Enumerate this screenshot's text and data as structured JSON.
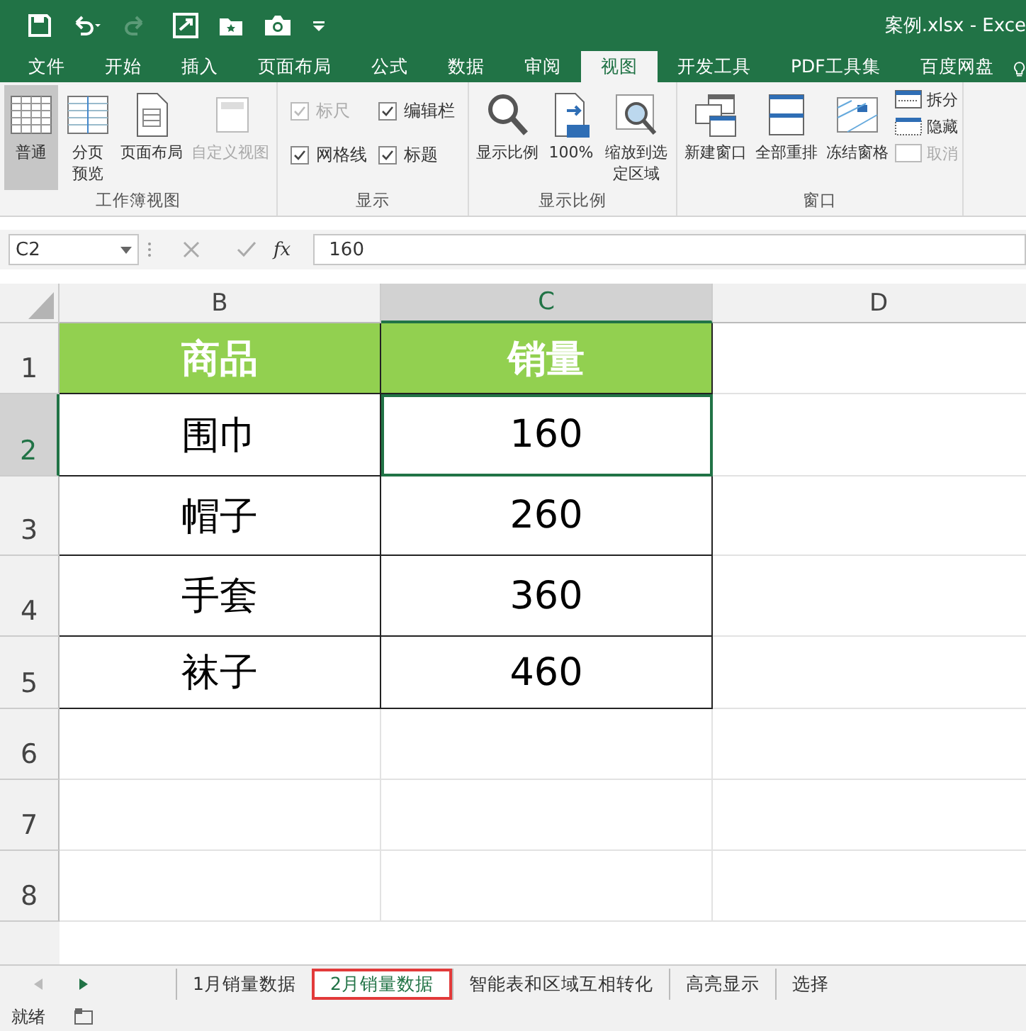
{
  "window": {
    "title": "案例.xlsx - Exce"
  },
  "menu_tabs": [
    {
      "label": "文件",
      "selected": false
    },
    {
      "label": "开始",
      "selected": false
    },
    {
      "label": "插入",
      "selected": false
    },
    {
      "label": "页面布局",
      "selected": false
    },
    {
      "label": "公式",
      "selected": false
    },
    {
      "label": "数据",
      "selected": false
    },
    {
      "label": "审阅",
      "selected": false
    },
    {
      "label": "视图",
      "selected": true
    },
    {
      "label": "开发工具",
      "selected": false
    },
    {
      "label": "PDF工具集",
      "selected": false
    },
    {
      "label": "百度网盘",
      "selected": false
    }
  ],
  "ribbon": [
    {
      "name": "工作簿视图",
      "items": [
        {
          "kind": "big",
          "label": "普通",
          "selected": true,
          "disabled": false
        },
        {
          "kind": "big",
          "label": "分页预览",
          "selected": false,
          "disabled": false
        },
        {
          "kind": "big",
          "label": "页面布局",
          "selected": false,
          "disabled": false
        },
        {
          "kind": "big",
          "label": "自定义视图",
          "selected": false,
          "disabled": true
        }
      ]
    },
    {
      "name": "显示",
      "items": [
        {
          "kind": "check",
          "label": "标尺",
          "checked": true,
          "disabled": true
        },
        {
          "kind": "check",
          "label": "编辑栏",
          "checked": true,
          "disabled": false
        },
        {
          "kind": "check",
          "label": "网格线",
          "checked": true,
          "disabled": false
        },
        {
          "kind": "check",
          "label": "标题",
          "checked": true,
          "disabled": false
        }
      ]
    },
    {
      "name": "显示比例",
      "items": [
        {
          "kind": "big",
          "label": "显示比例",
          "selected": false,
          "disabled": false
        },
        {
          "kind": "big",
          "label": "100%",
          "selected": false,
          "disabled": false
        },
        {
          "kind": "big",
          "label": "缩放到选定区域",
          "selected": false,
          "disabled": false
        }
      ]
    },
    {
      "name": "窗口",
      "items": [
        {
          "kind": "big",
          "label": "新建窗口",
          "selected": false,
          "disabled": false
        },
        {
          "kind": "big",
          "label": "全部重排",
          "selected": false,
          "disabled": false
        },
        {
          "kind": "big",
          "label": "冻结窗格",
          "selected": false,
          "disabled": false
        },
        {
          "kind": "small",
          "label": "拆分",
          "disabled": false
        },
        {
          "kind": "small",
          "label": "隐藏",
          "disabled": false
        },
        {
          "kind": "small",
          "label": "取消",
          "disabled": true
        }
      ]
    }
  ],
  "formula_bar": {
    "name_box": "C2",
    "fx": "fx",
    "value": "160"
  },
  "sheet": {
    "columns": [
      {
        "label": "B",
        "selected": false
      },
      {
        "label": "C",
        "selected": true
      },
      {
        "label": "D",
        "selected": false
      }
    ],
    "rows": [
      {
        "label": "1",
        "selected": false,
        "kind": "header",
        "cells": [
          "商品",
          "销量"
        ]
      },
      {
        "label": "2",
        "selected": true,
        "kind": "data",
        "cells": [
          "围巾",
          "160"
        ]
      },
      {
        "label": "3",
        "selected": false,
        "kind": "data",
        "cells": [
          "帽子",
          "260"
        ]
      },
      {
        "label": "4",
        "selected": false,
        "kind": "data",
        "cells": [
          "手套",
          "360"
        ]
      },
      {
        "label": "5",
        "selected": false,
        "kind": "data",
        "cells": [
          "袜子",
          "460"
        ]
      },
      {
        "label": "6",
        "selected": false,
        "kind": "empty",
        "cells": []
      },
      {
        "label": "7",
        "selected": false,
        "kind": "empty",
        "cells": []
      },
      {
        "label": "8",
        "selected": false,
        "kind": "empty",
        "cells": []
      }
    ]
  },
  "sheet_tabs": [
    {
      "label": "1月销量数据",
      "selected": false
    },
    {
      "label": "2月销量数据",
      "selected": true
    },
    {
      "label": "智能表和区域互相转化",
      "selected": false
    },
    {
      "label": "高亮显示",
      "selected": false
    },
    {
      "label": "选择",
      "selected": false
    }
  ],
  "status_bar": {
    "text": "就绪"
  }
}
